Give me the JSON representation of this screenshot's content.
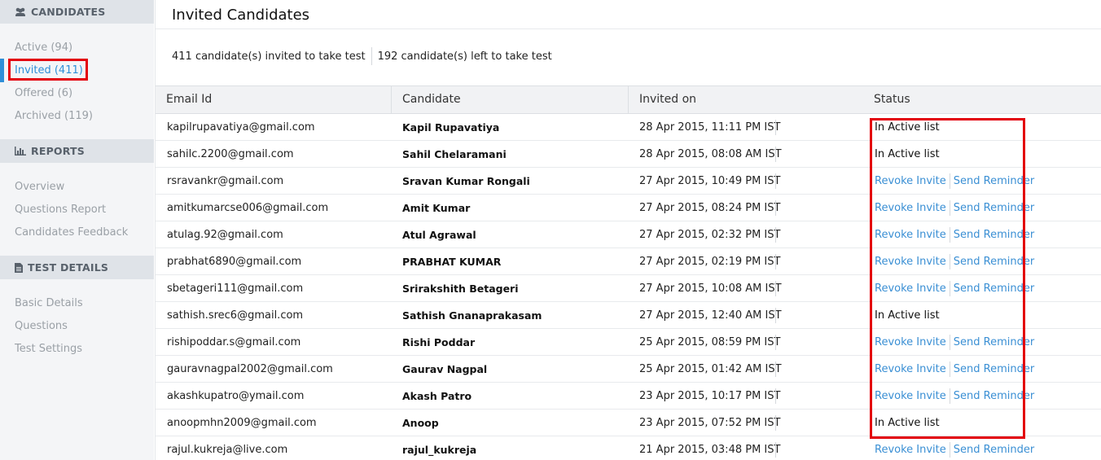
{
  "sidebar": {
    "candidates_header": "CANDIDATES",
    "candidates_items": [
      "Active (94)",
      "Invited (411)",
      "Offered (6)",
      "Archived (119)"
    ],
    "reports_header": "REPORTS",
    "reports_items": [
      "Overview",
      "Questions Report",
      "Candidates Feedback"
    ],
    "test_header": "TEST DETAILS",
    "test_items": [
      "Basic Details",
      "Questions",
      "Test Settings"
    ]
  },
  "main": {
    "title": "Invited Candidates",
    "summary_invited": "411 candidate(s) invited to take test",
    "summary_left": "192 candidate(s) left to take test",
    "columns": [
      "Email Id",
      "Candidate",
      "Invited on",
      "Status"
    ],
    "revoke_label": "Revoke Invite",
    "reminder_label": "Send Reminder",
    "active_label": "In Active list",
    "rows": [
      {
        "email": "kapilrupavatiya@gmail.com",
        "name": "Kapil Rupavatiya",
        "date": "28 Apr 2015, 11:11 PM IST",
        "status": "active"
      },
      {
        "email": "sahilc.2200@gmail.com",
        "name": "Sahil Chelaramani",
        "date": "28 Apr 2015, 08:08 AM IST",
        "status": "active"
      },
      {
        "email": "rsravankr@gmail.com",
        "name": "Sravan Kumar Rongali",
        "date": "27 Apr 2015, 10:49 PM IST",
        "status": "pending"
      },
      {
        "email": "amitkumarcse006@gmail.com",
        "name": "Amit Kumar",
        "date": "27 Apr 2015, 08:24 PM IST",
        "status": "pending"
      },
      {
        "email": "atulag.92@gmail.com",
        "name": "Atul Agrawal",
        "date": "27 Apr 2015, 02:32 PM IST",
        "status": "pending"
      },
      {
        "email": "prabhat6890@gmail.com",
        "name": "PRABHAT KUMAR",
        "date": "27 Apr 2015, 02:19 PM IST",
        "status": "pending"
      },
      {
        "email": "sbetageri111@gmail.com",
        "name": "Srirakshith Betageri",
        "date": "27 Apr 2015, 10:08 AM IST",
        "status": "pending"
      },
      {
        "email": "sathish.srec6@gmail.com",
        "name": "Sathish Gnanaprakasam",
        "date": "27 Apr 2015, 12:40 AM IST",
        "status": "active"
      },
      {
        "email": "rishipoddar.s@gmail.com",
        "name": "Rishi Poddar",
        "date": "25 Apr 2015, 08:59 PM IST",
        "status": "pending"
      },
      {
        "email": "gauravnagpal2002@gmail.com",
        "name": "Gaurav Nagpal",
        "date": "25 Apr 2015, 01:42 AM IST",
        "status": "pending"
      },
      {
        "email": "akashkupatro@ymail.com",
        "name": "Akash Patro",
        "date": "23 Apr 2015, 10:17 PM IST",
        "status": "pending"
      },
      {
        "email": "anoopmhn2009@gmail.com",
        "name": "Anoop",
        "date": "23 Apr 2015, 07:52 PM IST",
        "status": "active"
      },
      {
        "email": "rajul.kukreja@live.com",
        "name": "rajul_kukreja",
        "date": "21 Apr 2015, 03:48 PM IST",
        "status": "pending"
      }
    ]
  },
  "colors": {
    "accent": "#2f8fd8",
    "link": "#3a8fd4",
    "highlight": "#e3000b"
  }
}
